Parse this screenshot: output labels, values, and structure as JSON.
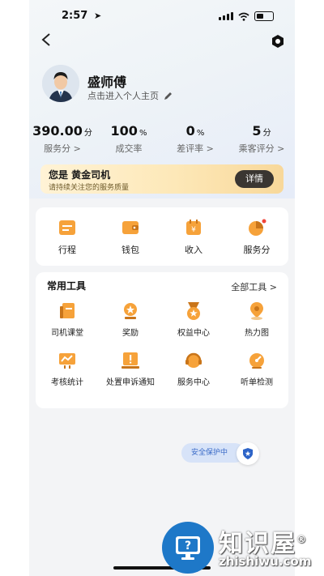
{
  "status_bar": {
    "time": "2:57"
  },
  "profile": {
    "name": "盛师傅",
    "subtitle": "点击进入个人主页"
  },
  "stats": [
    {
      "value": "390.00",
      "unit": "分",
      "label": "服务分 >"
    },
    {
      "value": "100",
      "unit": "%",
      "label": "成交率"
    },
    {
      "value": "0",
      "unit": "%",
      "label": "差评率 >"
    },
    {
      "value": "5",
      "unit": "分",
      "label": "乘客评分 >"
    }
  ],
  "gold_banner": {
    "title": "您是 黄金司机",
    "subtitle": "请持续关注您的服务质量",
    "button": "详情"
  },
  "quick_actions": [
    {
      "label": "行程",
      "icon": "itinerary-icon"
    },
    {
      "label": "钱包",
      "icon": "wallet-icon"
    },
    {
      "label": "收入",
      "icon": "income-icon"
    },
    {
      "label": "服务分",
      "icon": "service-score-icon"
    }
  ],
  "tools": {
    "title": "常用工具",
    "all_label": "全部工具 >",
    "items": [
      {
        "label": "司机课堂",
        "icon": "driver-class-icon"
      },
      {
        "label": "奖励",
        "icon": "reward-icon"
      },
      {
        "label": "权益中心",
        "icon": "benefits-icon"
      },
      {
        "label": "热力图",
        "icon": "heatmap-icon"
      },
      {
        "label": "考核统计",
        "icon": "assessment-stats-icon"
      },
      {
        "label": "处置申诉通知",
        "icon": "appeal-notice-icon"
      },
      {
        "label": "服务中心",
        "icon": "service-center-icon"
      },
      {
        "label": "听单检测",
        "icon": "order-listening-check-icon"
      }
    ]
  },
  "safety": {
    "label": "安全保护中"
  },
  "watermark": {
    "brand": "知识屋",
    "url": "zhishiwu.com"
  },
  "colors": {
    "accent_orange": "#f6a23a",
    "banner_button": "#3a3632",
    "safety_blue": "#3a6bc7"
  }
}
